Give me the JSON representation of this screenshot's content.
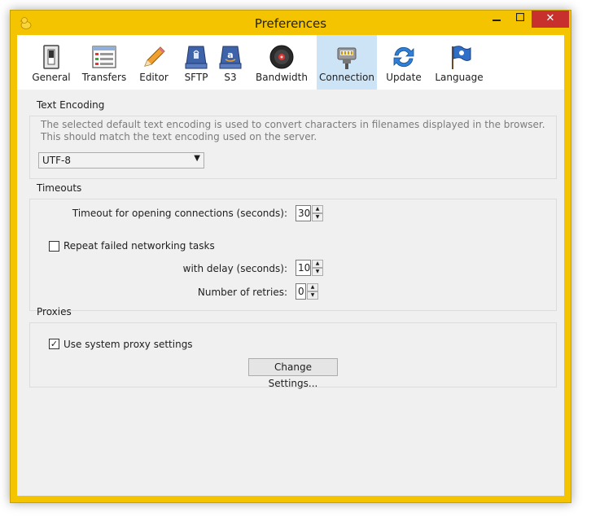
{
  "window": {
    "title": "Preferences",
    "minimize_icon": "minimize-icon",
    "maximize_icon": "maximize-icon",
    "close_label": "✕"
  },
  "toolbar": {
    "tabs": [
      {
        "label": "General",
        "icon": "switch-icon"
      },
      {
        "label": "Transfers",
        "icon": "transfers-list-icon"
      },
      {
        "label": "Editor",
        "icon": "pencil-icon"
      },
      {
        "label": "SFTP",
        "icon": "sftp-drive-icon"
      },
      {
        "label": "S3",
        "icon": "amazon-s3-drive-icon"
      },
      {
        "label": "Bandwidth",
        "icon": "speaker-icon"
      },
      {
        "label": "Connection",
        "icon": "network-plug-icon"
      },
      {
        "label": "Update",
        "icon": "refresh-icon"
      },
      {
        "label": "Language",
        "icon": "flag-icon"
      }
    ],
    "active": "Connection"
  },
  "text_encoding": {
    "title": "Text Encoding",
    "description": "The selected default text encoding is used to convert characters in filenames displayed in the browser. This should match the text encoding used on the server.",
    "selected": "UTF-8",
    "arrow": "▼"
  },
  "timeouts": {
    "title": "Timeouts",
    "timeout_label": "Timeout for opening connections (seconds):",
    "timeout_value": "30",
    "repeat_label": "Repeat failed networking tasks",
    "repeat_checked": false,
    "delay_label": "with delay (seconds):",
    "delay_value": "10",
    "retries_label": "Number of retries:",
    "retries_value": "0",
    "spin_up": "▲",
    "spin_down": "▼"
  },
  "proxies": {
    "title": "Proxies",
    "system_proxy_label": "Use system proxy settings",
    "system_proxy_checked": true,
    "check_mark": "✓",
    "change_button": "Change Settings..."
  },
  "colors": {
    "accent": "#cde4f7",
    "window_border": "#f4c400",
    "close": "#c7302c"
  }
}
